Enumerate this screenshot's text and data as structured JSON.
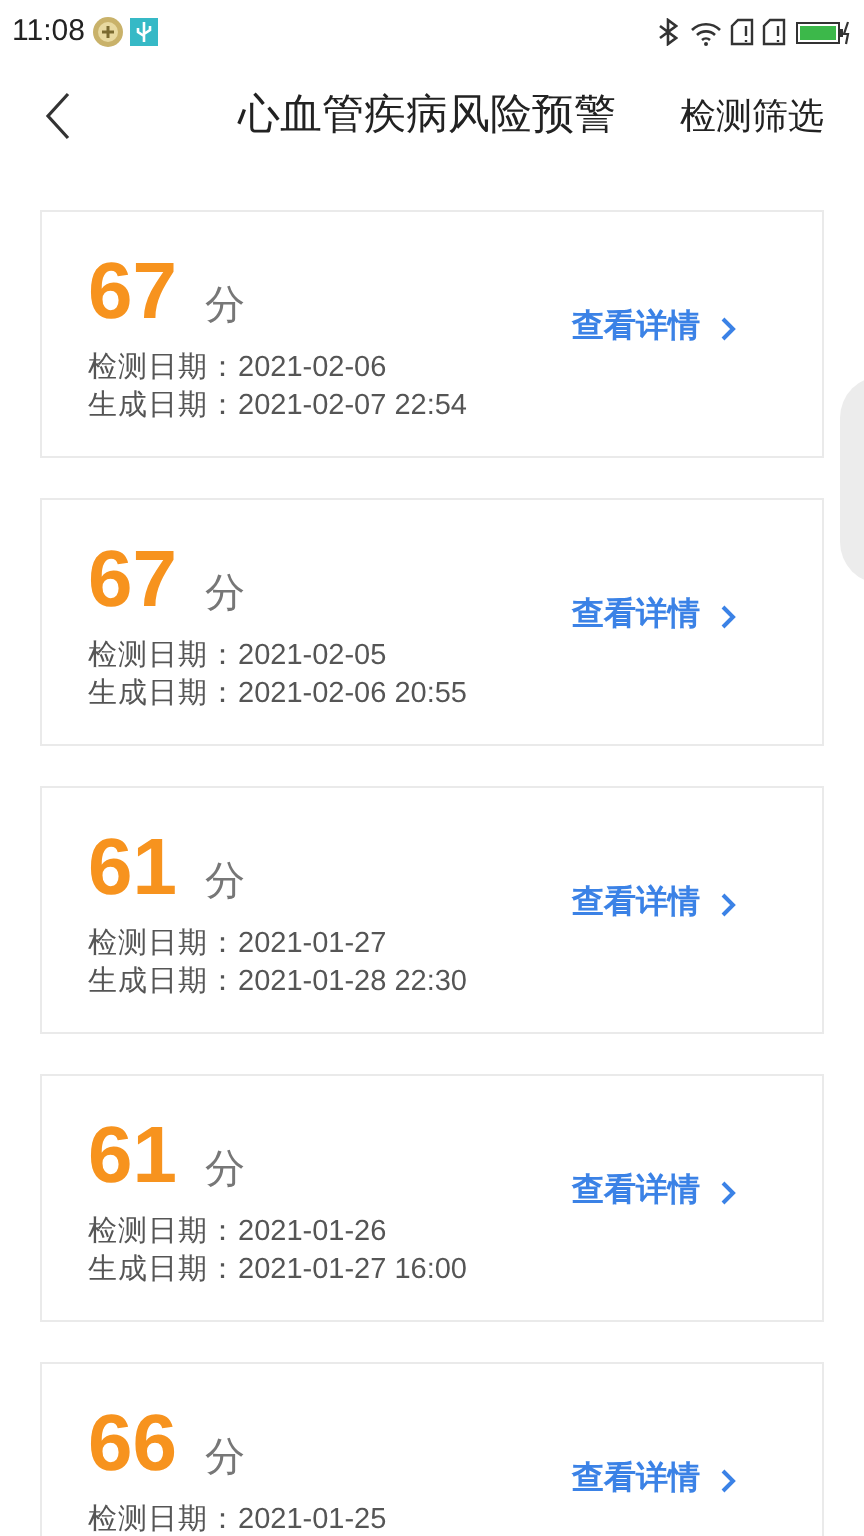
{
  "status_bar": {
    "time": "11:08"
  },
  "header": {
    "title": "心血管疾病风险预警",
    "action": "检测筛选"
  },
  "records": [
    {
      "score": "67",
      "unit": "分",
      "detect_label": "检测日期：",
      "detect_date": "2021-02-06",
      "gen_label": "生成日期：",
      "gen_date": "2021-02-07 22:54",
      "link": "查看详情"
    },
    {
      "score": "67",
      "unit": "分",
      "detect_label": "检测日期：",
      "detect_date": "2021-02-05",
      "gen_label": "生成日期：",
      "gen_date": "2021-02-06 20:55",
      "link": "查看详情"
    },
    {
      "score": "61",
      "unit": "分",
      "detect_label": "检测日期：",
      "detect_date": "2021-01-27",
      "gen_label": "生成日期：",
      "gen_date": "2021-01-28 22:30",
      "link": "查看详情"
    },
    {
      "score": "61",
      "unit": "分",
      "detect_label": "检测日期：",
      "detect_date": "2021-01-26",
      "gen_label": "生成日期：",
      "gen_date": "2021-01-27 16:00",
      "link": "查看详情"
    },
    {
      "score": "66",
      "unit": "分",
      "detect_label": "检测日期：",
      "detect_date": "2021-01-25",
      "link": "查看详情"
    }
  ]
}
